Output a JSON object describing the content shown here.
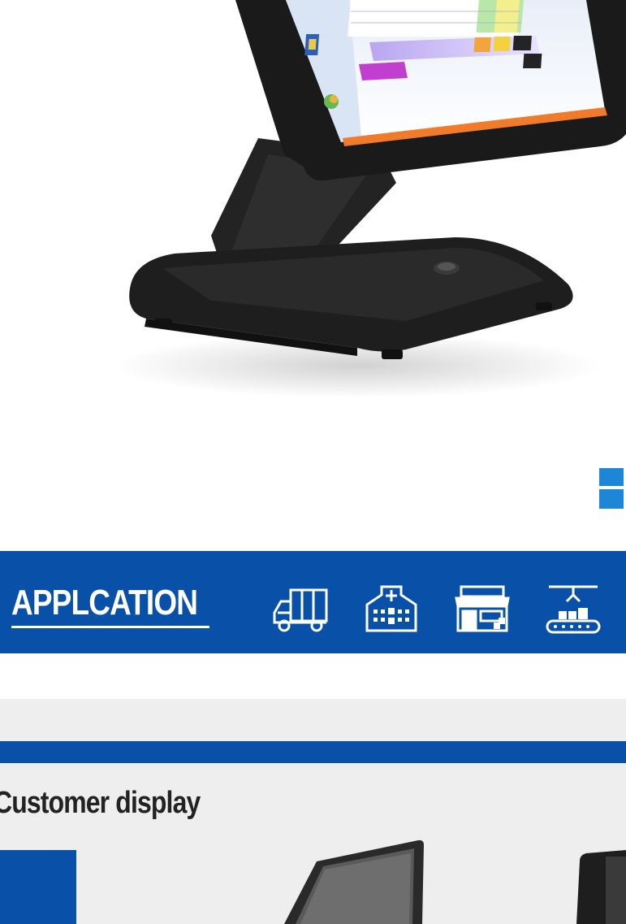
{
  "application": {
    "title": "APPLCATION",
    "icons": [
      "delivery-truck-icon",
      "hospital-icon",
      "shop-icon",
      "factory-conveyor-icon"
    ]
  },
  "customer_display": {
    "title": "Customer display"
  },
  "colors": {
    "brand_blue": "#0950a8",
    "section_gray": "#eeeeee"
  }
}
